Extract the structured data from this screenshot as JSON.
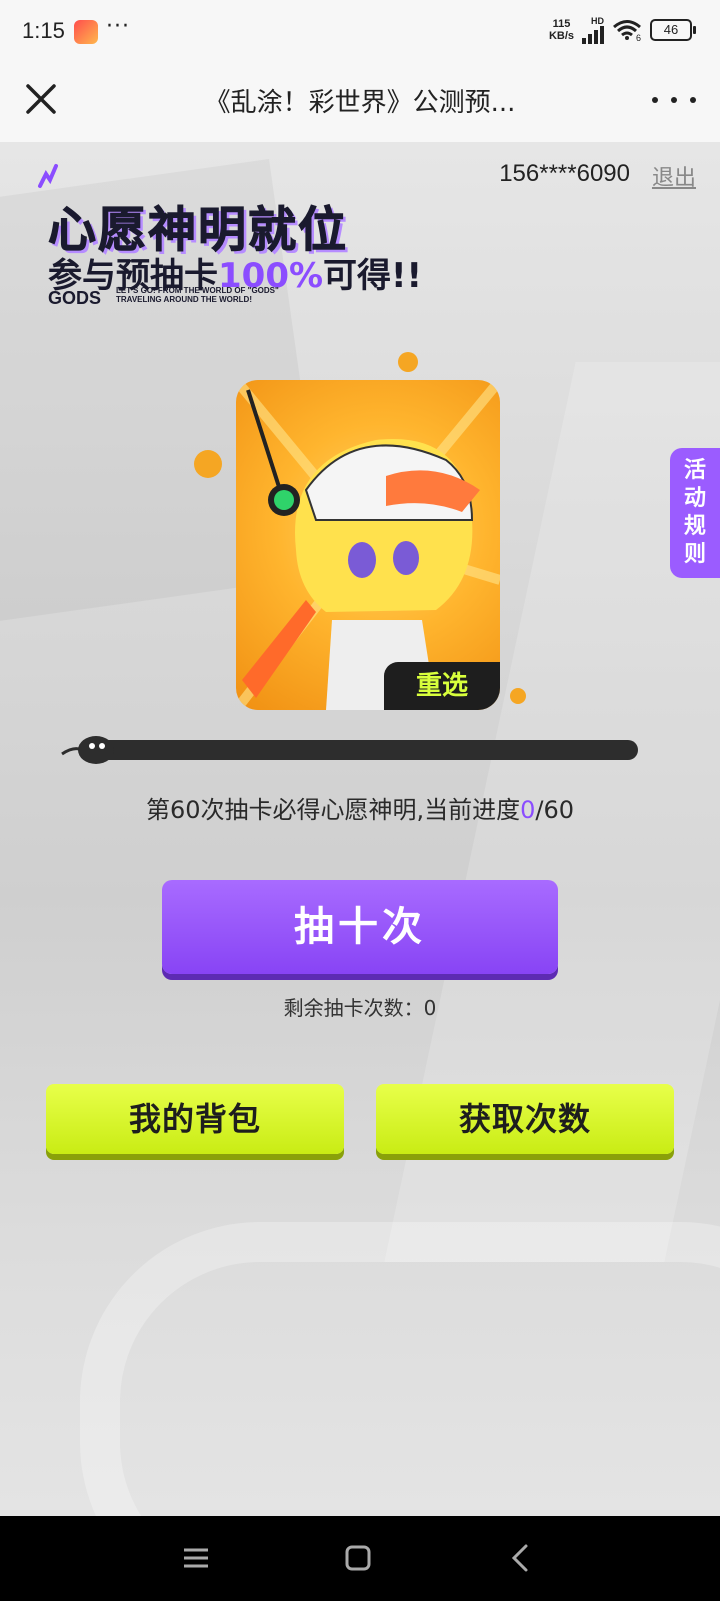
{
  "status": {
    "time": "1:15",
    "dots": "···",
    "net_speed_value": "115",
    "net_speed_unit": "KB/s",
    "network_type": "HD",
    "wifi_label": "6",
    "battery": "46"
  },
  "nav": {
    "title": "《乱涂！彩世界》公测预..."
  },
  "account": {
    "phone": "156****6090",
    "logout_label": "退出"
  },
  "headline": {
    "line1": "心愿神明就位",
    "line2_prefix": "参与预抽卡",
    "line2_highlight": "100%",
    "line2_suffix": "可得!!",
    "gods": "GODS",
    "gods_sub_line1": "LET'S GO! FROM THE WORLD OF \"GODS\"",
    "gods_sub_line2": "TRAVELING AROUND THE WORLD!"
  },
  "card": {
    "reselect_label": "重选"
  },
  "rules_tab": {
    "c1": "活",
    "c2": "动",
    "c3": "规",
    "c4": "则"
  },
  "progress": {
    "text_prefix": "第60次抽卡必得心愿神明,当前进度",
    "current": "0",
    "total_text": "/60",
    "current_value": 0,
    "total_value": 60
  },
  "draw_button_label": "抽十次",
  "remaining_text": "剩余抽卡次数：0",
  "bag_button_label": "我的背包",
  "get_times_button_label": "获取次数",
  "colors": {
    "accent_purple": "#9b5cff",
    "accent_lime": "#d4f51e",
    "card_orange": "#ffb52e"
  }
}
